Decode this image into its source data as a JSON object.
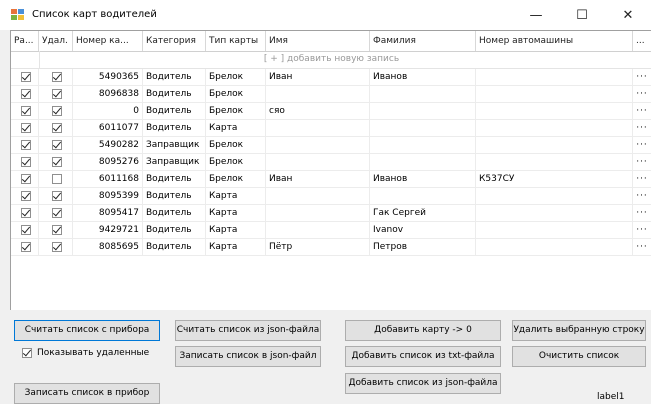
{
  "window": {
    "title": "Список карт водителей",
    "minimize_glyph": "—",
    "maximize_glyph": "☐",
    "close_glyph": "✕",
    "icon": "app-window-icon",
    "icon_colors": [
      "#e8743b",
      "#4a90d9",
      "#7cb342",
      "#f2c037"
    ]
  },
  "grid": {
    "columns": [
      "Ра...",
      "Удал.",
      "Номер ка...",
      "Категория",
      "Тип карты",
      "Имя",
      "Фамилия",
      "Номер автомашины",
      "..."
    ],
    "new_row_text": "[ + ] добавить новую запись",
    "rows": [
      {
        "selected": true,
        "deleted": true,
        "number": "5490365",
        "category": "Водитель",
        "type": "Брелок",
        "name": "Иван",
        "surname": "Иванов",
        "car": "",
        "more": "···"
      },
      {
        "selected": true,
        "deleted": true,
        "number": "8096838",
        "category": "Водитель",
        "type": "Брелок",
        "name": "",
        "surname": "",
        "car": "",
        "more": "···"
      },
      {
        "selected": true,
        "deleted": true,
        "number": "0",
        "category": "Водитель",
        "type": "Брелок",
        "name": "сяо",
        "surname": "",
        "car": "",
        "more": "···"
      },
      {
        "selected": true,
        "deleted": true,
        "number": "6011077",
        "category": "Водитель",
        "type": "Карта",
        "name": "",
        "surname": "",
        "car": "",
        "more": "···"
      },
      {
        "selected": true,
        "deleted": true,
        "number": "5490282",
        "category": "Заправщик",
        "type": "Брелок",
        "name": "",
        "surname": "",
        "car": "",
        "more": "···"
      },
      {
        "selected": true,
        "deleted": true,
        "number": "8095276",
        "category": "Заправщик",
        "type": "Брелок",
        "name": "",
        "surname": "",
        "car": "",
        "more": "···"
      },
      {
        "selected": true,
        "deleted": false,
        "number": "6011168",
        "category": "Водитель",
        "type": "Брелок",
        "name": "Иван",
        "surname": "Иванов",
        "car": "К537СУ",
        "more": "···"
      },
      {
        "selected": true,
        "deleted": true,
        "number": "8095399",
        "category": "Водитель",
        "type": "Карта",
        "name": "",
        "surname": "",
        "car": "",
        "more": "···"
      },
      {
        "selected": true,
        "deleted": true,
        "number": "8095417",
        "category": "Водитель",
        "type": "Карта",
        "name": "",
        "surname": "Гак Сергей",
        "car": "",
        "more": "···"
      },
      {
        "selected": true,
        "deleted": true,
        "number": "9429721",
        "category": "Водитель",
        "type": "Карта",
        "name": "",
        "surname": "Ivanov",
        "car": "",
        "more": "···"
      },
      {
        "selected": true,
        "deleted": true,
        "number": "8085695",
        "category": "Водитель",
        "type": "Карта",
        "name": "Пётр",
        "surname": "Петров",
        "car": "",
        "more": "···"
      }
    ]
  },
  "buttons": {
    "read_device": "Считать список с прибора",
    "read_json": "Считать список из json-файла",
    "add_card": "Добавить карту -> 0",
    "delete_row": "Удалить выбранную строку",
    "write_json": "Записать список в json-файл",
    "add_txt": "Добавить список из txt-файла",
    "clear_list": "Очистить список",
    "add_json": "Добавить список из json-файла",
    "write_device": "Записать список в прибор"
  },
  "show_deleted": {
    "label": "Показывать удаленные",
    "checked": true
  },
  "status_label": "label1",
  "colors": {
    "focus_border": "#0078d7",
    "button_bg": "#e1e1e1",
    "window_bg": "#f0f0f0"
  }
}
